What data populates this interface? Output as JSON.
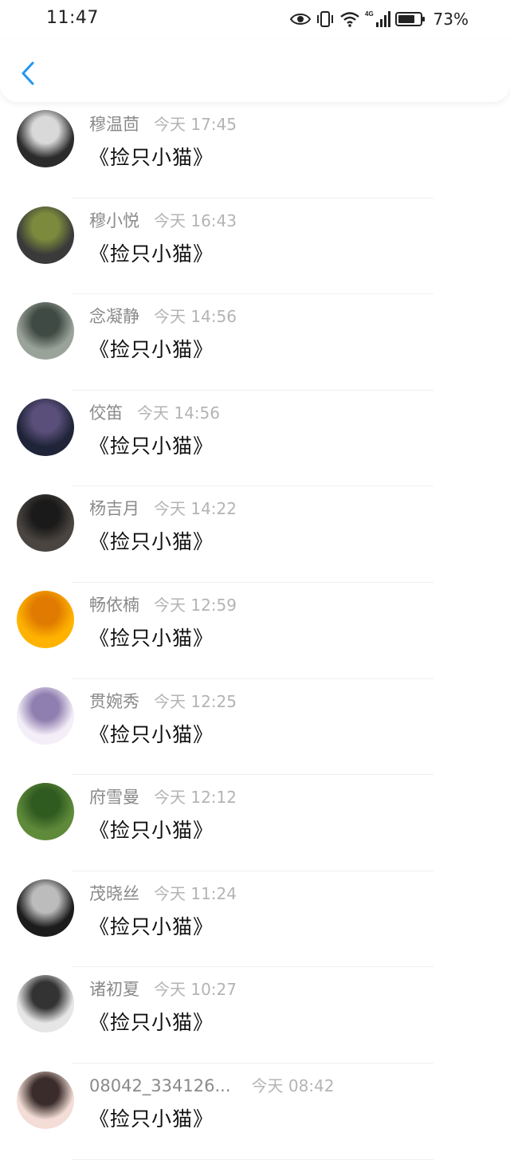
{
  "status_bar": {
    "time": "11:47",
    "battery_percent": "73%"
  },
  "header": {
    "back_icon": "chevron-left-icon",
    "accent_color": "#2196f3"
  },
  "messages": [
    {
      "name": "穆温茴",
      "time": "今天 17:45",
      "text": "《捡只小猫》",
      "avatar_colors": [
        "#2b2b2b",
        "#d9d9d9"
      ]
    },
    {
      "name": "穆小悦",
      "time": "今天 16:43",
      "text": "《捡只小猫》",
      "avatar_colors": [
        "#3a3a3a",
        "#7b8a3c"
      ]
    },
    {
      "name": "念凝静",
      "time": "今天 14:56",
      "text": "《捡只小猫》",
      "avatar_colors": [
        "#9aa39a",
        "#3f4a44"
      ]
    },
    {
      "name": "佼笛",
      "time": "今天 14:56",
      "text": "《捡只小猫》",
      "avatar_colors": [
        "#1f2438",
        "#5a4f7a"
      ]
    },
    {
      "name": "杨吉月",
      "time": "今天 14:22",
      "text": "《捡只小猫》",
      "avatar_colors": [
        "#4a4540",
        "#1a1a1a"
      ]
    },
    {
      "name": "畅依楠",
      "time": "今天 12:59",
      "text": "《捡只小猫》",
      "avatar_colors": [
        "#ffb300",
        "#e07a00"
      ]
    },
    {
      "name": "贯婉秀",
      "time": "今天 12:25",
      "text": "《捡只小猫》",
      "avatar_colors": [
        "#f4eef8",
        "#8f7fb0"
      ]
    },
    {
      "name": "府雪曼",
      "time": "今天 12:12",
      "text": "《捡只小猫》",
      "avatar_colors": [
        "#5f8a3a",
        "#2f5a20"
      ]
    },
    {
      "name": "茂晓丝",
      "time": "今天 11:24",
      "text": "《捡只小猫》",
      "avatar_colors": [
        "#1c1c1c",
        "#bcbcbc"
      ]
    },
    {
      "name": "诸初夏",
      "time": "今天 10:27",
      "text": "《捡只小猫》",
      "avatar_colors": [
        "#e6e6e6",
        "#333333"
      ]
    },
    {
      "name": "08042_334126...",
      "time": "今天 08:42",
      "text": "《捡只小猫》",
      "avatar_colors": [
        "#f3ddd6",
        "#3a2c2a"
      ]
    }
  ]
}
